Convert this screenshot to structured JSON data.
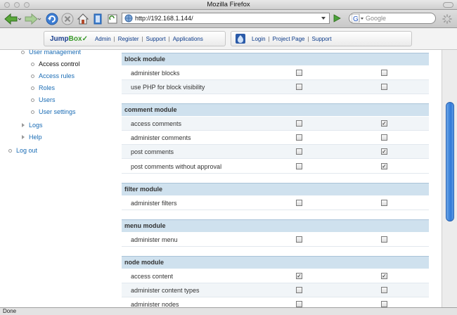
{
  "window": {
    "title": "Mozilla Firefox"
  },
  "navbar": {
    "url": "http://192.168.1.144/",
    "search_placeholder": "Google"
  },
  "jumpbox": {
    "logo_main": "Jump",
    "logo_sub": "Box",
    "links": [
      "Admin",
      "Register",
      "Support",
      "Applications"
    ],
    "right_links": [
      "Login",
      "Project Page",
      "Support"
    ]
  },
  "sidebar": {
    "user_management": "User management",
    "sub_items": [
      "Access control",
      "Access rules",
      "Roles",
      "Users",
      "User settings"
    ],
    "logs": "Logs",
    "help": "Help",
    "logout": "Log out"
  },
  "modules": [
    {
      "name": "block module",
      "perms": [
        {
          "label": "administer blocks",
          "c1": false,
          "c2": false
        },
        {
          "label": "use PHP for block visibility",
          "c1": false,
          "c2": false
        }
      ]
    },
    {
      "name": "comment module",
      "perms": [
        {
          "label": "access comments",
          "c1": false,
          "c2": true
        },
        {
          "label": "administer comments",
          "c1": false,
          "c2": false
        },
        {
          "label": "post comments",
          "c1": false,
          "c2": true
        },
        {
          "label": "post comments without approval",
          "c1": false,
          "c2": true
        }
      ]
    },
    {
      "name": "filter module",
      "perms": [
        {
          "label": "administer filters",
          "c1": false,
          "c2": false
        }
      ]
    },
    {
      "name": "menu module",
      "perms": [
        {
          "label": "administer menu",
          "c1": false,
          "c2": false
        }
      ]
    },
    {
      "name": "node module",
      "perms": [
        {
          "label": "access content",
          "c1": true,
          "c2": true
        },
        {
          "label": "administer content types",
          "c1": false,
          "c2": false
        },
        {
          "label": "administer nodes",
          "c1": false,
          "c2": false
        }
      ]
    }
  ],
  "status": {
    "text": "Done"
  },
  "colors": {
    "link": "#1a6cb5",
    "header_bg": "#cfe1ee",
    "scroll_thumb": "#2f79d6"
  }
}
